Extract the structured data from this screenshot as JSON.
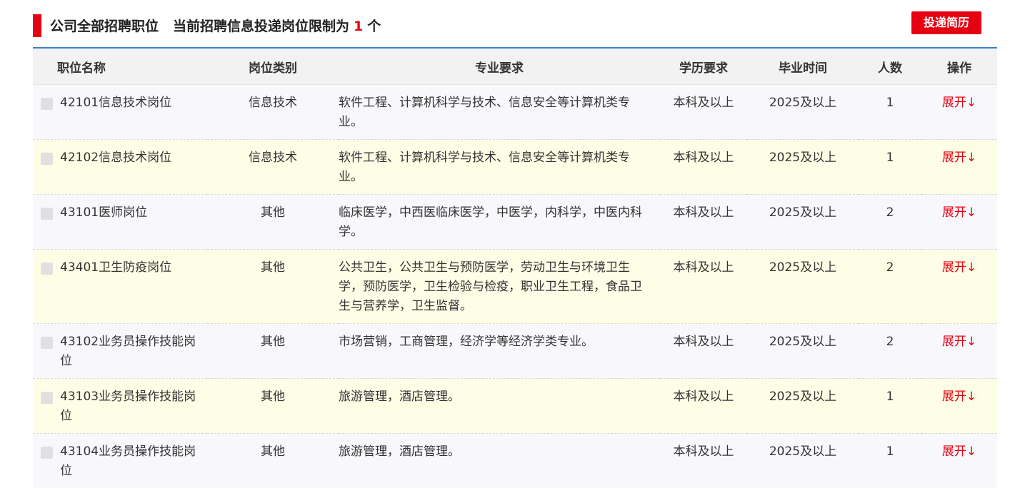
{
  "header": {
    "title": "公司全部招聘职位",
    "limit_prefix": "当前招聘信息投递岗位限制为",
    "limit_count": "1",
    "limit_suffix": "个",
    "submit_label": "投递简历"
  },
  "colors": {
    "accent": "#e60012",
    "header_line": "#3d7fc7",
    "row_odd": "#f8f8fc",
    "row_even": "#fefee6"
  },
  "table": {
    "columns": [
      "职位名称",
      "岗位类别",
      "专业要求",
      "学历要求",
      "毕业时间",
      "人数",
      "操作"
    ],
    "rows": [
      {
        "name": "42101信息技术岗位",
        "category": "信息技术",
        "major": "软件工程、计算机科学与技术、信息安全等计算机类专业。",
        "education": "本科及以上",
        "graduation": "2025及以上",
        "count": "1",
        "action": "展开↓"
      },
      {
        "name": "42102信息技术岗位",
        "category": "信息技术",
        "major": "软件工程、计算机科学与技术、信息安全等计算机类专业。",
        "education": "本科及以上",
        "graduation": "2025及以上",
        "count": "1",
        "action": "展开↓"
      },
      {
        "name": "43101医师岗位",
        "category": "其他",
        "major": "临床医学，中西医临床医学，中医学，内科学，中医内科学。",
        "education": "本科及以上",
        "graduation": "2025及以上",
        "count": "2",
        "action": "展开↓"
      },
      {
        "name": "43401卫生防疫岗位",
        "category": "其他",
        "major": "公共卫生，公共卫生与预防医学，劳动卫生与环境卫生学，预防医学，卫生检验与检疫，职业卫生工程，食品卫生与营养学，卫生监督。",
        "education": "本科及以上",
        "graduation": "2025及以上",
        "count": "2",
        "action": "展开↓"
      },
      {
        "name": "43102业务员操作技能岗位",
        "category": "其他",
        "major": "市场营销，工商管理，经济学等经济学类专业。",
        "education": "本科及以上",
        "graduation": "2025及以上",
        "count": "2",
        "action": "展开↓"
      },
      {
        "name": "43103业务员操作技能岗位",
        "category": "其他",
        "major": "旅游管理，酒店管理。",
        "education": "本科及以上",
        "graduation": "2025及以上",
        "count": "1",
        "action": "展开↓"
      },
      {
        "name": "43104业务员操作技能岗位",
        "category": "其他",
        "major": "旅游管理，酒店管理。",
        "education": "本科及以上",
        "graduation": "2025及以上",
        "count": "1",
        "action": "展开↓"
      }
    ]
  }
}
